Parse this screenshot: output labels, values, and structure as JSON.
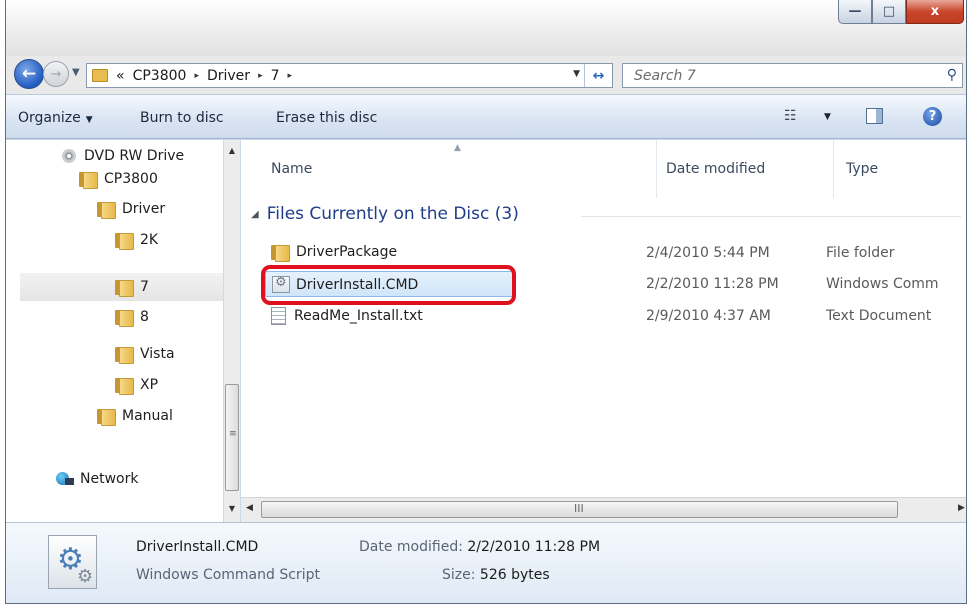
{
  "window": {
    "caption_buttons": {
      "minimize": "—",
      "maximize": "□",
      "close": "x"
    }
  },
  "nav": {
    "back_glyph": "←",
    "forward_glyph": "→",
    "breadcrumb": [
      "«",
      "CP3800",
      "▸",
      "Driver",
      "▸",
      "7",
      "▸"
    ],
    "search_placeholder": "Search 7"
  },
  "toolbar": {
    "organize": "Organize",
    "burn": "Burn to disc",
    "erase": "Erase this disc"
  },
  "tree": [
    {
      "label": "DVD RW Drive",
      "icon": "dvd-icon"
    },
    {
      "label": "CP3800",
      "icon": "folder-icon"
    },
    {
      "label": "Driver",
      "icon": "folder-icon"
    },
    {
      "label": "2K",
      "icon": "folder-icon"
    },
    {
      "label": "7",
      "icon": "folder-icon",
      "selected": true
    },
    {
      "label": "8",
      "icon": "folder-icon"
    },
    {
      "label": "Vista",
      "icon": "folder-icon"
    },
    {
      "label": "XP",
      "icon": "folder-icon"
    },
    {
      "label": "Manual",
      "icon": "folder-icon"
    },
    {
      "label": "Network",
      "icon": "network-icon"
    }
  ],
  "columns": {
    "name": "Name",
    "date": "Date modified",
    "type": "Type"
  },
  "group": {
    "title": "Files Currently on the Disc (3)"
  },
  "files": [
    {
      "name": "DriverPackage",
      "date": "2/4/2010 5:44 PM",
      "type": "File folder",
      "icon": "folder-icon"
    },
    {
      "name": "DriverInstall.CMD",
      "date": "2/2/2010 11:28 PM",
      "type": "Windows Comm",
      "icon": "cmd-script-icon",
      "selected": true
    },
    {
      "name": "ReadMe_Install.txt",
      "date": "2/9/2010 4:37 AM",
      "type": "Text Document",
      "icon": "text-file-icon"
    }
  ],
  "details": {
    "name": "DriverInstall.CMD",
    "type": "Windows Command Script",
    "date_label": "Date modified:",
    "date_value": "2/2/2010 11:28 PM",
    "size_label": "Size:",
    "size_value": "526 bytes"
  },
  "scroll": {
    "grip": "≡",
    "hgrip": "III"
  },
  "colors": {
    "highlight": "#e0111e",
    "group_header": "#1f3d8a"
  }
}
